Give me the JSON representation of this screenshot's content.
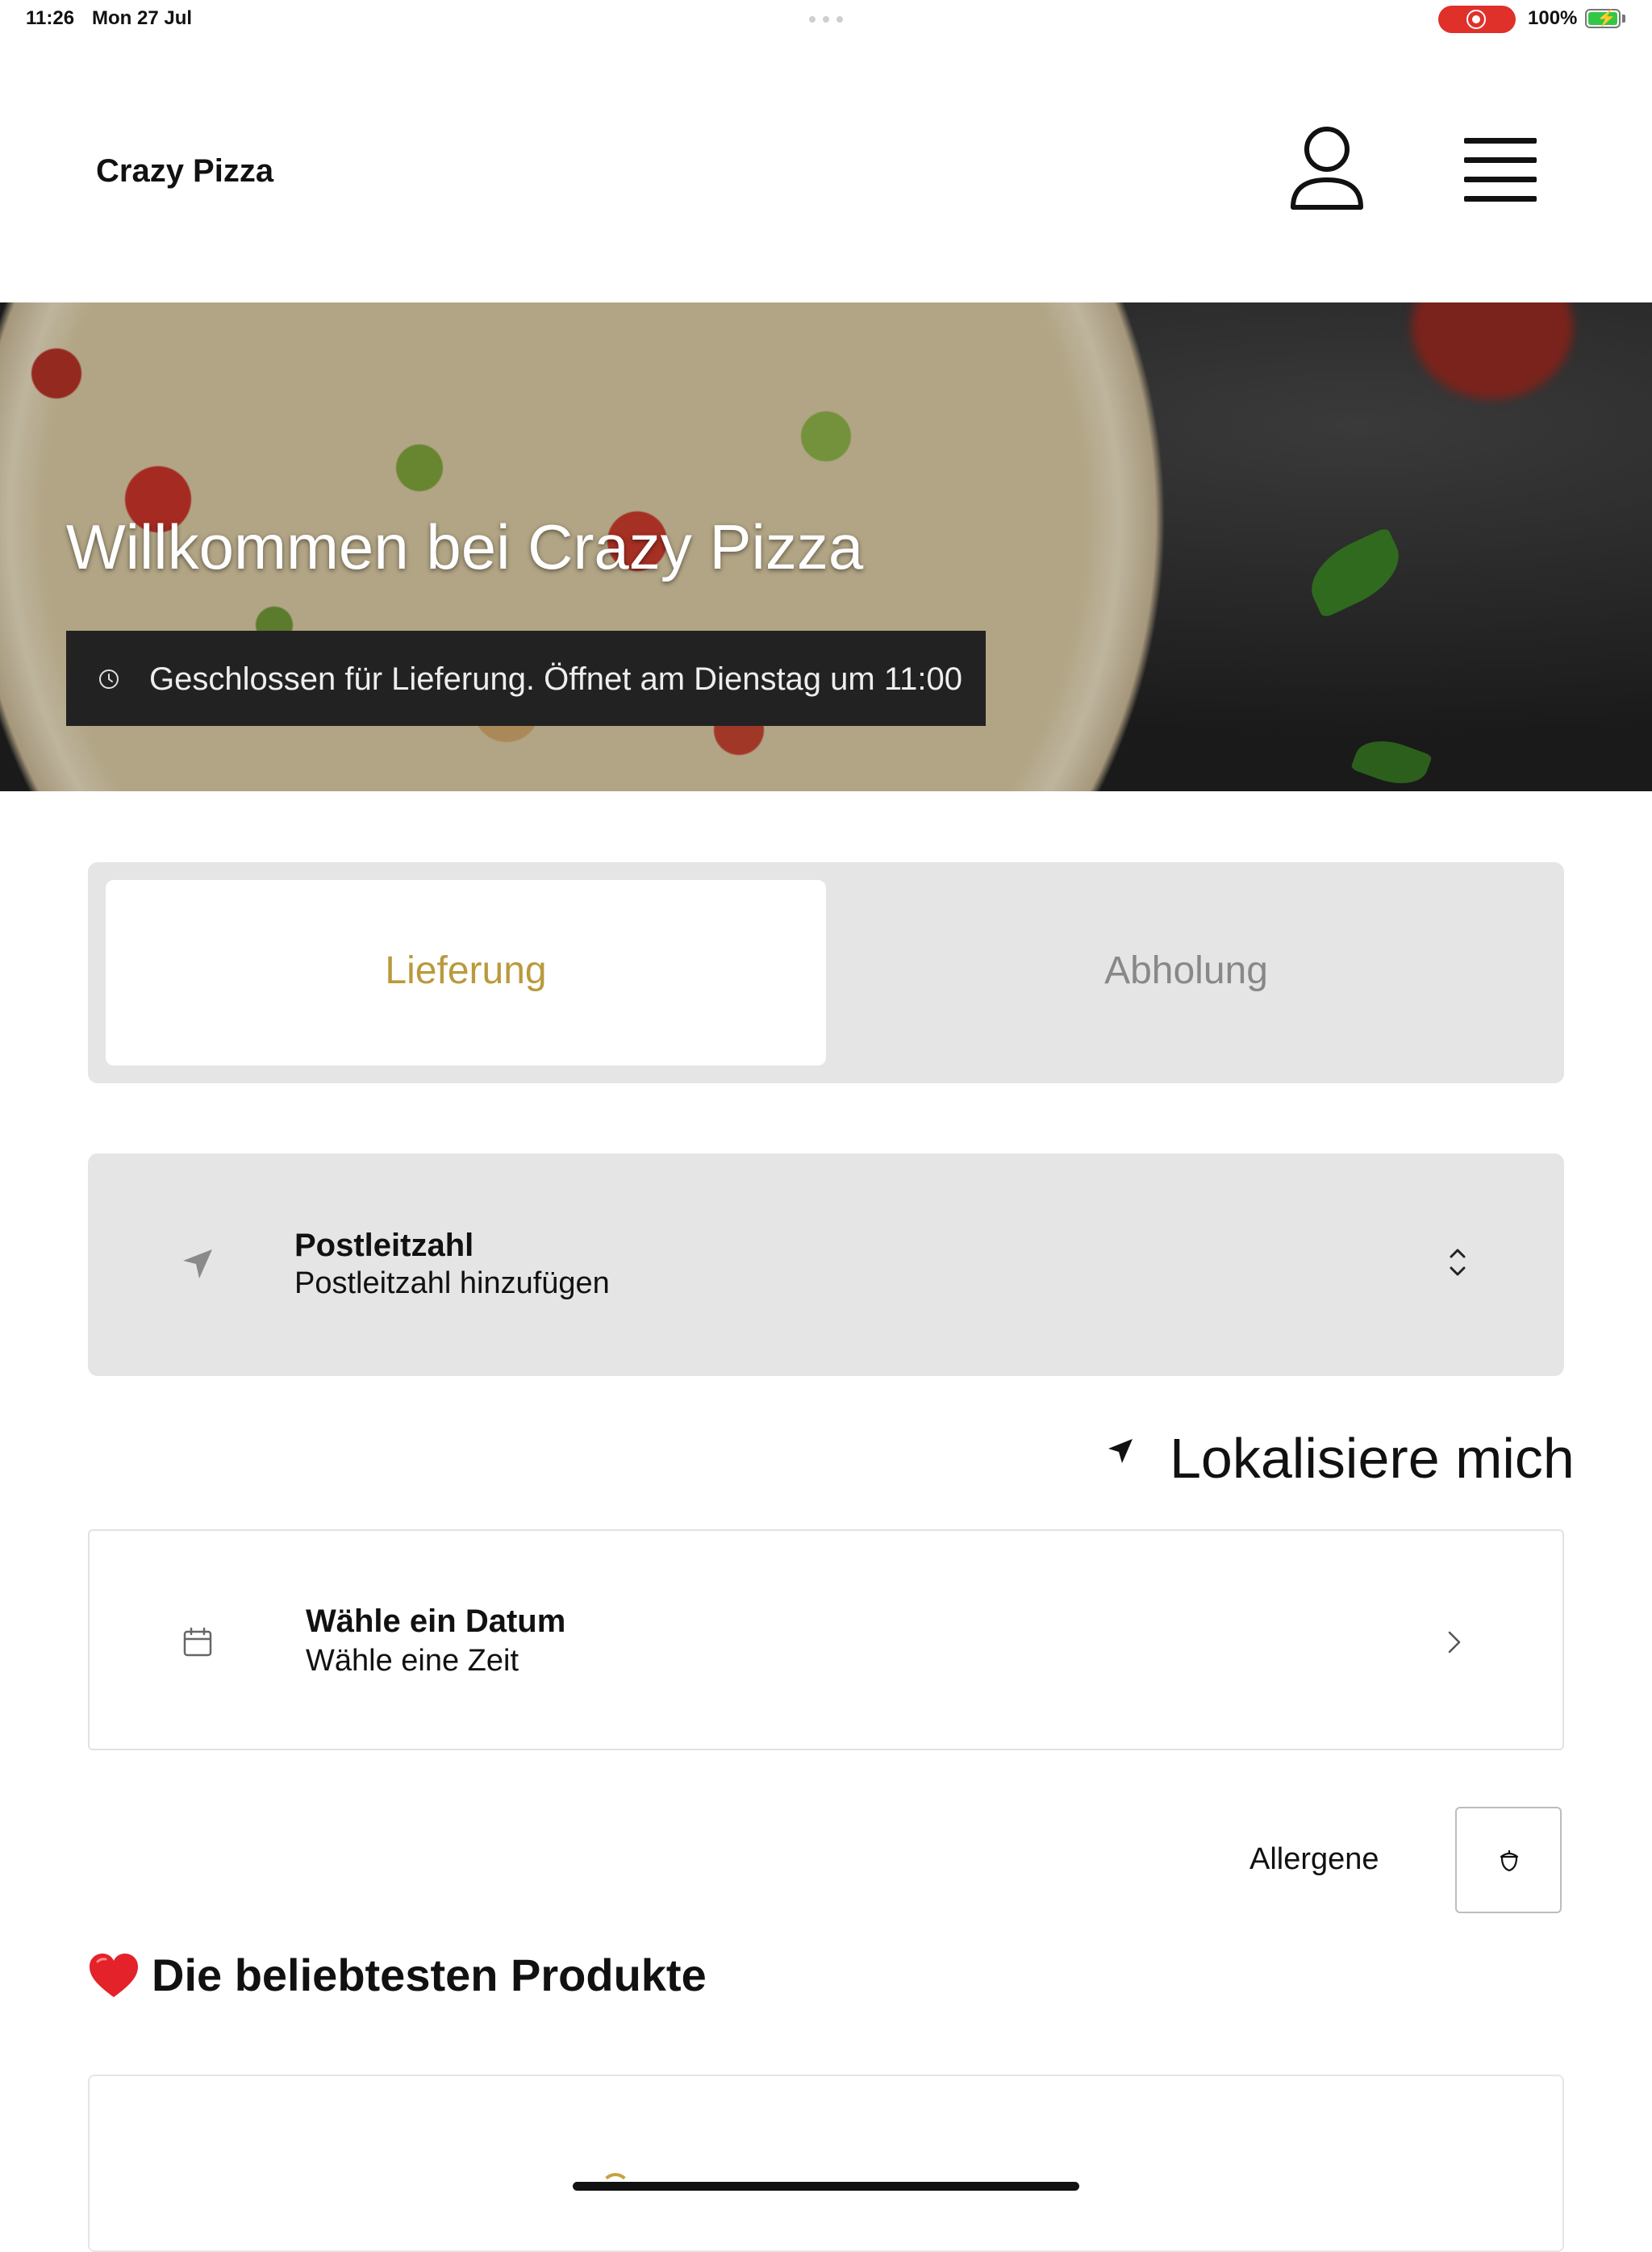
{
  "status_bar": {
    "time": "11:26",
    "date": "Mon 27 Jul",
    "battery": "100%",
    "recording_color": "#e0302a",
    "battery_color": "#33c748"
  },
  "header": {
    "brand": "Crazy Pizza",
    "user_icon": "user-icon",
    "menu_icon": "hamburger-menu-icon"
  },
  "hero": {
    "title": "Willkommen bei Crazy Pizza",
    "status_icon": "clock-icon",
    "status_text": "Geschlossen für Lieferung. Öffnet am Dienstag um 11:00"
  },
  "order_mode": {
    "options": [
      {
        "label": "Lieferung",
        "selected": true
      },
      {
        "label": "Abholung",
        "selected": false
      }
    ],
    "accent_color": "#b99a3c"
  },
  "postal": {
    "label": "Postleitzahl",
    "placeholder": "Postleitzahl hinzufügen",
    "icon": "location-arrow-icon",
    "chevron": "chevron-up-down-icon"
  },
  "locate": {
    "label": "Lokalisiere mich",
    "icon": "location-arrow-icon"
  },
  "schedule": {
    "date_label": "Wähle ein Datum",
    "time_label": "Wähle eine Zeit",
    "icon": "calendar-icon",
    "chevron": "chevron-right-icon"
  },
  "allergens": {
    "label": "Allergene",
    "icon": "acorn-icon"
  },
  "popular": {
    "icon": "heart-icon",
    "title": "Die beliebtesten Produkte"
  }
}
